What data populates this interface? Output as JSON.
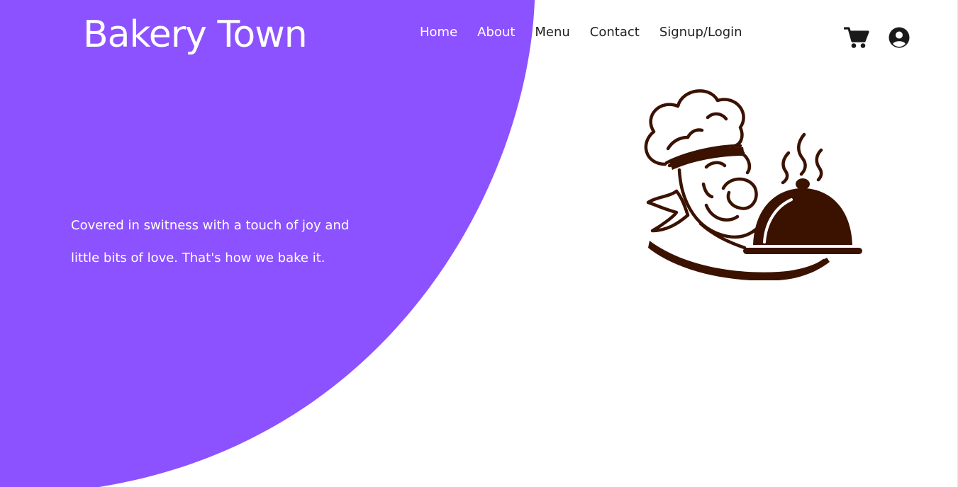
{
  "brand": {
    "name": "Bakery Town"
  },
  "nav": {
    "items": [
      {
        "label": "Home"
      },
      {
        "label": "About"
      },
      {
        "label": "Menu"
      },
      {
        "label": "Contact"
      },
      {
        "label": "Signup/Login"
      }
    ]
  },
  "header_icons": {
    "cart": "shopping-cart-icon",
    "user": "user-circle-icon"
  },
  "hero": {
    "tagline_line1": "Covered in switness with a touch of joy and",
    "tagline_line2": "little bits of love. That's how we bake it.",
    "illustration": "chef-with-cloche-icon"
  },
  "colors": {
    "accent_purple": "#8C52FF",
    "illustration_brown": "#3B1200",
    "icon_dark": "#1a1a1a"
  }
}
